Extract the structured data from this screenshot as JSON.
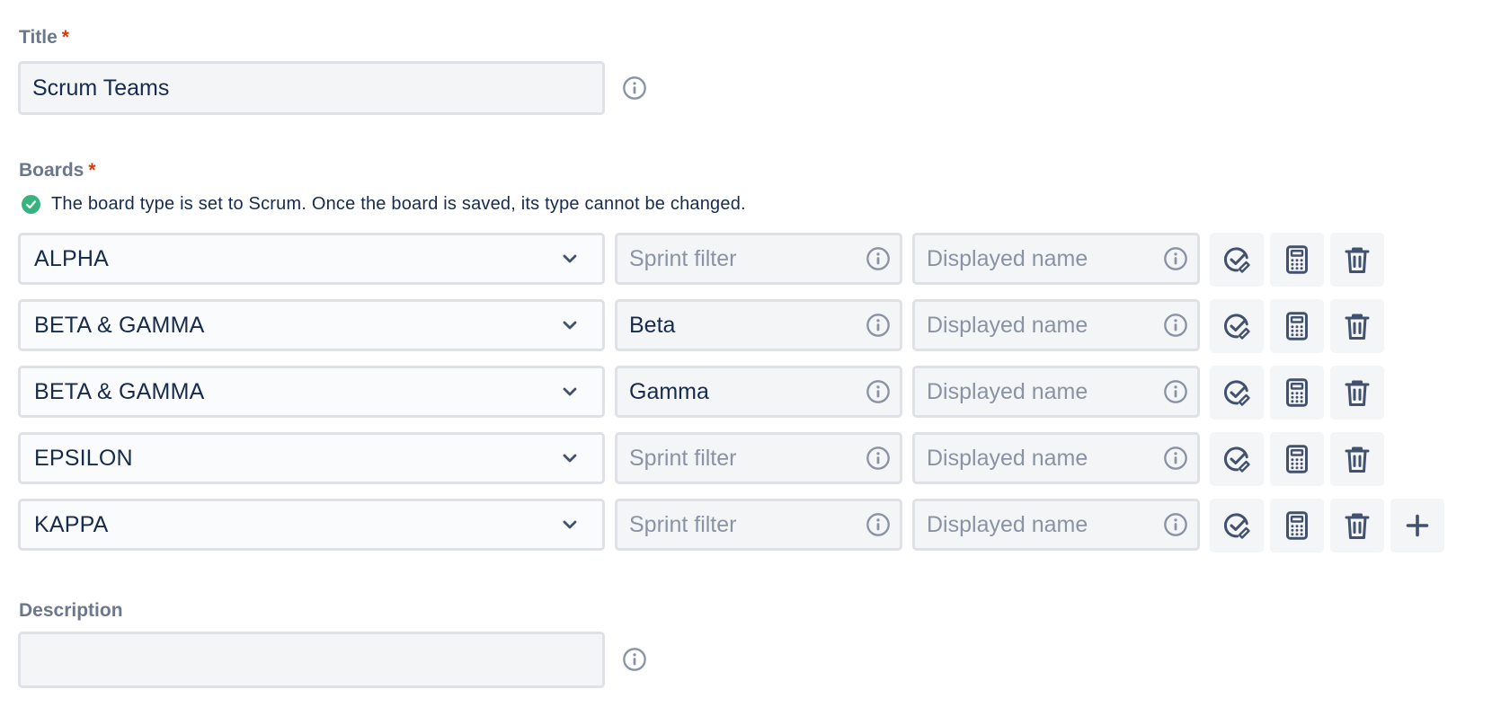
{
  "title_section": {
    "label": "Title",
    "required_mark": "*",
    "value": "Scrum Teams"
  },
  "boards_section": {
    "label": "Boards",
    "required_mark": "*",
    "hint": "The board type is set to Scrum. Once the board is saved, its type cannot be changed.",
    "sprint_filter_placeholder": "Sprint filter",
    "displayed_name_placeholder": "Displayed name",
    "rows": [
      {
        "board": "ALPHA",
        "sprint_filter": "",
        "displayed_name": ""
      },
      {
        "board": "BETA & GAMMA",
        "sprint_filter": "Beta",
        "displayed_name": ""
      },
      {
        "board": "BETA & GAMMA",
        "sprint_filter": "Gamma",
        "displayed_name": ""
      },
      {
        "board": "EPSILON",
        "sprint_filter": "",
        "displayed_name": ""
      },
      {
        "board": "KAPPA",
        "sprint_filter": "",
        "displayed_name": ""
      }
    ]
  },
  "description_section": {
    "label": "Description",
    "value": ""
  },
  "colors": {
    "label": "#6b778c",
    "required": "#de350b",
    "success": "#36b37e",
    "icon": "#42526e",
    "field_bg": "#f4f5f7",
    "field_border": "#dfe1e6"
  },
  "icons": {
    "row_actions": [
      "check-badge-icon",
      "calculator-icon",
      "trash-icon"
    ],
    "add": "plus-icon",
    "info": "info-icon",
    "chevron": "chevron-down-icon"
  }
}
